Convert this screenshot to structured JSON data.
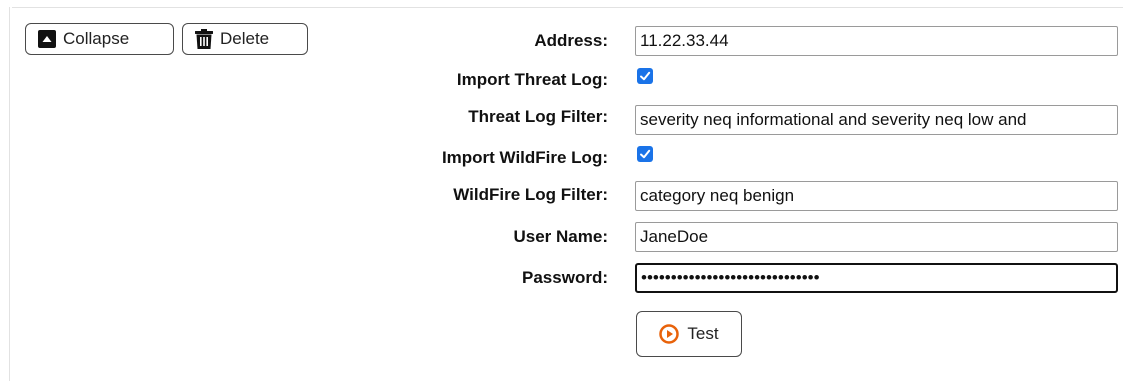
{
  "toolbar": {
    "collapse_label": "Collapse",
    "collapse_icon": "collapse-up-icon",
    "delete_label": "Delete",
    "delete_icon": "trash-icon"
  },
  "form": {
    "address": {
      "label": "Address:",
      "value": "11.22.33.44"
    },
    "import_threat_log": {
      "label": "Import Threat Log:",
      "checked": true
    },
    "threat_log_filter": {
      "label": "Threat Log Filter:",
      "value": "severity neq informational and severity neq low and"
    },
    "import_wildfire_log": {
      "label": "Import WildFire Log:",
      "checked": true
    },
    "wildfire_log_filter": {
      "label": "WildFire Log Filter:",
      "value": "category neq benign"
    },
    "user_name": {
      "label": "User Name:",
      "value": "JaneDoe"
    },
    "password": {
      "label": "Password:",
      "value": "••••••••••••••••••••••••••••••"
    }
  },
  "test_button": {
    "label": "Test",
    "icon": "play-circle-icon",
    "icon_color": "#e8620a"
  },
  "colors": {
    "checkbox": "#1a73e8",
    "accent": "#e8620a"
  }
}
